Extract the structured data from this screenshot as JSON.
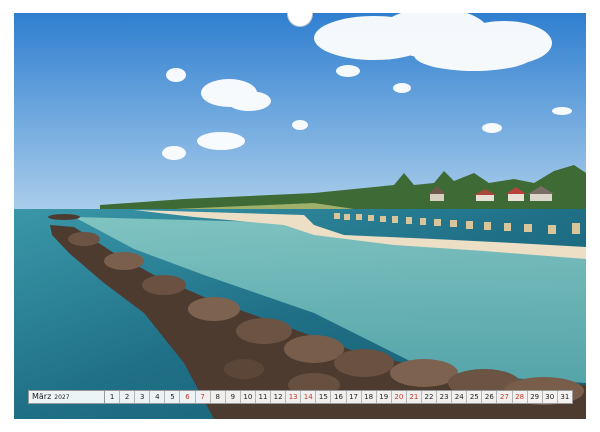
{
  "calendar": {
    "month": "März",
    "year": "2027",
    "days": [
      "1",
      "2",
      "3",
      "4",
      "5",
      "6",
      "7",
      "8",
      "9",
      "10",
      "11",
      "12",
      "13",
      "14",
      "15",
      "16",
      "17",
      "18",
      "19",
      "20",
      "21",
      "22",
      "23",
      "24",
      "25",
      "26",
      "27",
      "28",
      "29",
      "30",
      "31"
    ],
    "weekend_days": [
      "6",
      "7",
      "13",
      "14",
      "20",
      "21",
      "27",
      "28"
    ]
  },
  "colors": {
    "sky_top": "#2f7fd0",
    "sky_bottom": "#a9cdeb",
    "sea_deep": "#1f6f86",
    "sea_shallow": "#7fc3c0",
    "sand": "#ecdfc6",
    "rocks": "#5a4537",
    "weekend_text": "#c0392b"
  }
}
